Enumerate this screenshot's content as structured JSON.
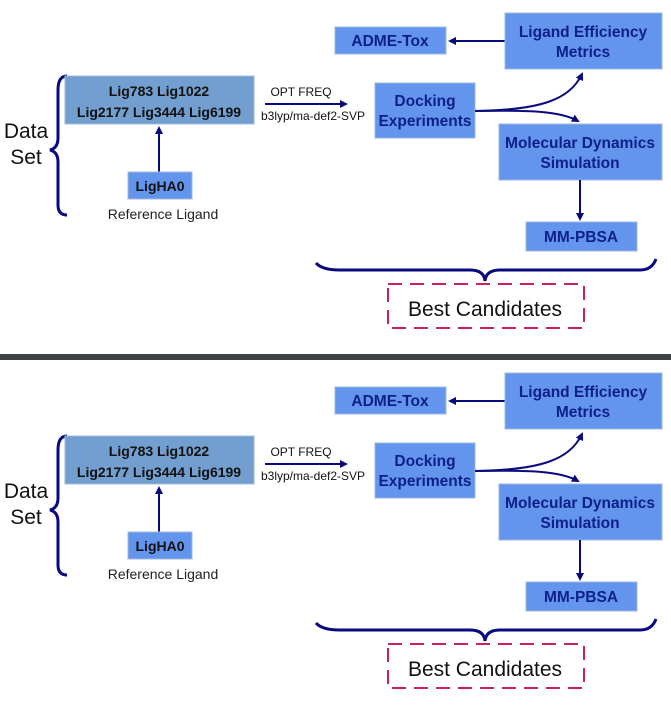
{
  "panels": [
    {
      "data_set_label": [
        "Data",
        "Set"
      ],
      "ligands_box": [
        "Lig783 Lig1022",
        "Lig2177 Lig3444 Lig6199"
      ],
      "reference_box": "LigHA0",
      "reference_caption": "Reference Ligand",
      "arrow_label_top": "OPT FREQ",
      "arrow_label_bottom": "b3lyp/ma-def2-SVP",
      "docking_box": [
        "Docking",
        "Experiments"
      ],
      "adme_box": "ADME-Tox",
      "lem_box": [
        "Ligand Efficiency",
        "Metrics"
      ],
      "md_box": [
        "Molecular Dynamics",
        "Simulation"
      ],
      "mmpbsa_box": "MM-PBSA",
      "best_candidates": "Best Candidates"
    },
    {
      "data_set_label": [
        "Data",
        "Set"
      ],
      "ligands_box": [
        "Lig783 Lig1022",
        "Lig2177 Lig3444 Lig6199"
      ],
      "reference_box": "LigHA0",
      "reference_caption": "Reference Ligand",
      "arrow_label_top": "OPT FREQ",
      "arrow_label_bottom": "b3lyp/ma-def2-SVP",
      "docking_box": [
        "Docking",
        "Experiments"
      ],
      "adme_box": "ADME-Tox",
      "lem_box": [
        "Ligand Efficiency",
        "Metrics"
      ],
      "md_box": [
        "Molecular Dynamics",
        "Simulation"
      ],
      "mmpbsa_box": "MM-PBSA",
      "best_candidates": "Best Candidates"
    }
  ],
  "colors": {
    "box_blue": "#6495ed",
    "ligand_box": "#729fcf",
    "arrow": "#0a0a80",
    "dash": "#d0205a"
  }
}
